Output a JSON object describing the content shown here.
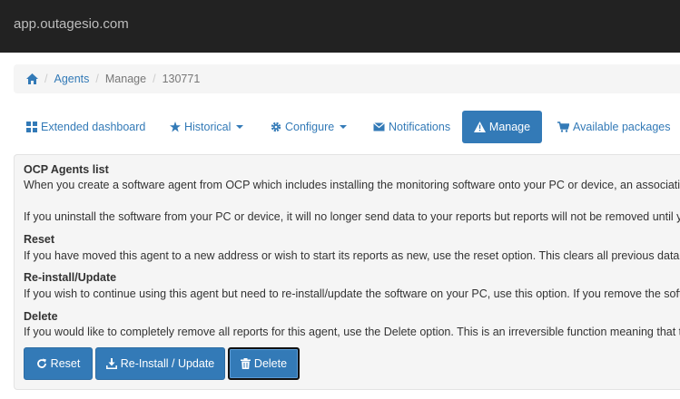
{
  "browser": {
    "host": "app.outagesio.com"
  },
  "breadcrumb": {
    "home_icon": "home-icon",
    "items": [
      "Agents",
      "Manage",
      "130771"
    ]
  },
  "tabs": [
    {
      "label": "Extended dashboard",
      "icon": "grid-icon"
    },
    {
      "label": "Historical",
      "icon": "star-icon",
      "dropdown": true
    },
    {
      "label": "Configure",
      "icon": "gear-icon",
      "dropdown": true
    },
    {
      "label": "Notifications",
      "icon": "envelope-icon"
    },
    {
      "label": "Manage",
      "icon": "warning-icon",
      "active": true
    },
    {
      "label": "Available packages",
      "icon": "cart-icon"
    }
  ],
  "panel": {
    "title": "OCP Agents list",
    "intro": "When you create a software agent from OCP which includes installing the monitoring software onto your PC or device, an association is c",
    "uninstall": "If you uninstall the software from your PC or device, it will no longer send data to your reports but reports will not be removed until you de",
    "sections": [
      {
        "heading": "Reset",
        "text": "If you have moved this agent to a new address or wish to start its reports as new, use the reset option. This clears all previous data and r"
      },
      {
        "heading": "Re-install/Update",
        "text": "If you wish to continue using this agent but need to re-install/update the software on your PC, use this option. If you remove the software"
      },
      {
        "heading": "Delete",
        "text": "If you would like to completely remove all reports for this agent, use the Delete option. This is an irreversible function meaning that this ag"
      }
    ]
  },
  "actions": {
    "reset": "Reset",
    "reinstall": "Re-Install / Update",
    "delete": "Delete"
  },
  "colors": {
    "primary": "#337ab7",
    "topbar": "#222222",
    "panel_bg": "#f5f5f5"
  }
}
